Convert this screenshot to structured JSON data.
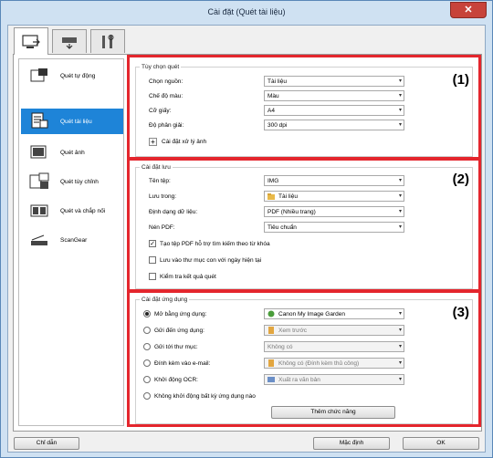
{
  "window": {
    "title": "Cài đặt (Quét tài liệu)"
  },
  "tabs": [
    {
      "icon": "scan-settings-icon"
    },
    {
      "icon": "scanner-icon"
    },
    {
      "icon": "tools-icon"
    }
  ],
  "sidebar": {
    "items": [
      {
        "label": "Quét tự động",
        "icon": "auto-scan-icon"
      },
      {
        "label": "Quét tài liệu",
        "icon": "document-scan-icon"
      },
      {
        "label": "Quét ảnh",
        "icon": "photo-scan-icon"
      },
      {
        "label": "Quét tùy chỉnh",
        "icon": "custom-scan-icon"
      },
      {
        "label": "Quét và chắp nối",
        "icon": "stitch-scan-icon"
      },
      {
        "label": "ScanGear",
        "icon": "scangear-icon"
      }
    ]
  },
  "scan_options": {
    "title": "Tùy chọn quét",
    "number": "(1)",
    "source_label": "Chọn nguồn:",
    "source_value": "Tài liệu",
    "color_label": "Chế độ màu:",
    "color_value": "Màu",
    "paper_label": "Cỡ giấy:",
    "paper_value": "A4",
    "resolution_label": "Độ phân giải:",
    "resolution_value": "300 dpi",
    "image_processing_label": "Cài đặt xử lý ảnh"
  },
  "save_settings": {
    "title": "Cài đặt lưu",
    "number": "(2)",
    "filename_label": "Tên tệp:",
    "filename_value": "IMG",
    "save_in_label": "Lưu trong:",
    "save_in_value": "Tài liệu",
    "format_label": "Định dạng dữ liệu:",
    "format_value": "PDF (Nhiều trang)",
    "pdf_compression_label": "Nén PDF:",
    "pdf_compression_value": "Tiêu chuẩn",
    "searchable_pdf_label": "Tạo tệp PDF hỗ trợ tìm kiếm theo từ khóa",
    "searchable_pdf_checked": true,
    "subfolder_label": "Lưu vào thư mục con với ngày hiện tại",
    "subfolder_checked": false,
    "check_results_label": "Kiểm tra kết quả quét",
    "check_results_checked": false
  },
  "app_settings": {
    "title": "Cài đặt ứng dụng",
    "number": "(3)",
    "open_app_label": "Mở bằng ứng dụng:",
    "open_app_value": "Canon My Image Garden",
    "send_app_label": "Gửi đến ứng dụng:",
    "send_app_value": "Xem trước",
    "send_folder_label": "Gửi tới thư mục:",
    "send_folder_value": "Không có",
    "email_label": "Đính kèm vào e-mail:",
    "email_value": "Không có (Đính kèm thủ công)",
    "ocr_label": "Khởi động OCR:",
    "ocr_value": "Xuất ra văn bản",
    "none_label": "Không khởi động bất kỳ ứng dụng nào",
    "add_function_label": "Thêm chức năng",
    "selected": "open_app"
  },
  "footer": {
    "instructions_label": "Chỉ dẫn",
    "defaults_label": "Mặc định",
    "ok_label": "OK"
  },
  "colors": {
    "highlight": "#e4262d",
    "selection": "#1e84d8"
  }
}
